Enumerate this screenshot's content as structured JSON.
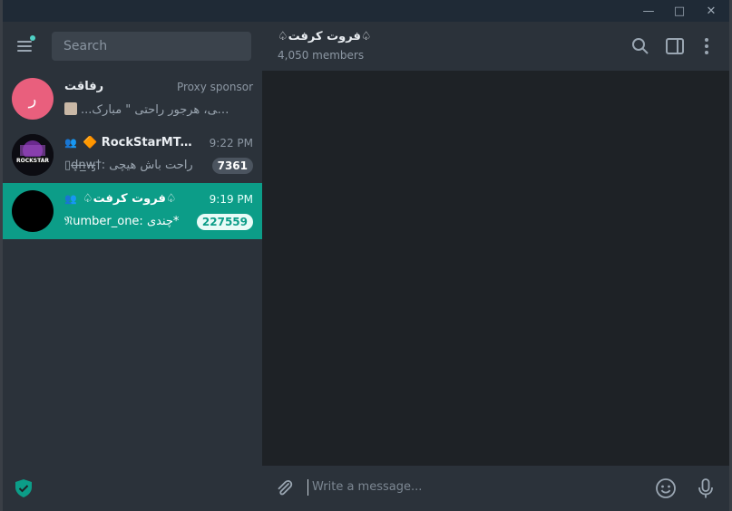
{
  "window": {
    "controls": [
      "—",
      "□",
      "✕"
    ]
  },
  "sidebar": {
    "search_placeholder": "Search",
    "chats": [
      {
        "avatar_letter": "ر",
        "avatar_color": "#e95f7d",
        "title": "رفاقت",
        "time": "Proxy sponsor",
        "preview": "...روز \" اوکی، هرجور راحتی \" مبارک",
        "badge": ""
      },
      {
        "avatar_text": "ROCKSTAR",
        "title": "🔶 RockStarMTA Gr...",
        "time": "9:22 PM",
        "preview": "▯d̶͎n̶̲w̶̡†: راحت باش هیچی",
        "badge": "7361"
      },
      {
        "title": "♤فروت کرفت♤",
        "time": "9:19 PM",
        "preview": "𝔑umber_one: چندی*",
        "badge": "227559"
      }
    ]
  },
  "chat": {
    "title": "♤فروت کرفت♤",
    "members": "4,050 members",
    "composer_placeholder": "Write a message..."
  },
  "colors": {
    "accent": "#0c9d88",
    "sidebar_bg": "#2b323a",
    "chat_bg": "#1e2226"
  }
}
